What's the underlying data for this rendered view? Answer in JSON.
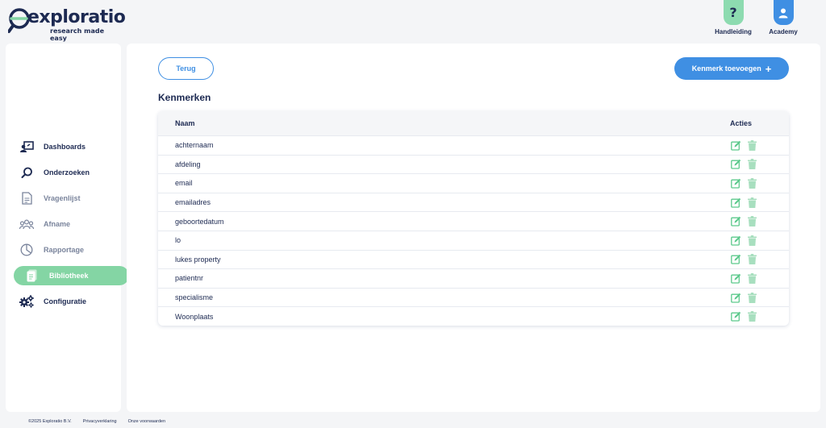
{
  "brand": {
    "name": "exploratio",
    "tagline": "research made easy"
  },
  "header": {
    "help_label": "Handleiding",
    "help_symbol": "?",
    "academy_label": "Academy"
  },
  "sidebar": {
    "items": [
      {
        "label": "Dashboards",
        "icon": "dashboard-icon",
        "state": "dark"
      },
      {
        "label": "Onderzoeken",
        "icon": "search-icon",
        "state": "dark"
      },
      {
        "label": "Vragenlijst",
        "icon": "document-icon",
        "state": "muted"
      },
      {
        "label": "Afname",
        "icon": "people-icon",
        "state": "muted"
      },
      {
        "label": "Rapportage",
        "icon": "pie-chart-icon",
        "state": "muted"
      },
      {
        "label": "Bibliotheek",
        "icon": "library-icon",
        "state": "active"
      },
      {
        "label": "Configuratie",
        "icon": "gears-icon",
        "state": "dark"
      }
    ]
  },
  "main": {
    "back_label": "Terug",
    "add_label": "Kenmerk toevoegen",
    "add_symbol": "+",
    "title": "Kenmerken",
    "table": {
      "col_name": "Naam",
      "col_actions": "Acties",
      "rows": [
        "achternaam",
        "afdeling",
        "email",
        "emailadres",
        "geboortedatum",
        "lo",
        "lukes property",
        "patientnr",
        "specialisme",
        "Woonplaats"
      ]
    }
  },
  "footer": {
    "copyright": "©2025 Exploratio B.V.",
    "privacy": "Privacyverklaring",
    "terms": "Onze voorwaarden"
  },
  "colors": {
    "navy": "#1d2a52",
    "blue": "#3f8fe3",
    "green": "#84d5a4",
    "action_green": "#5cc98c",
    "action_trash": "#a8dfbf"
  }
}
